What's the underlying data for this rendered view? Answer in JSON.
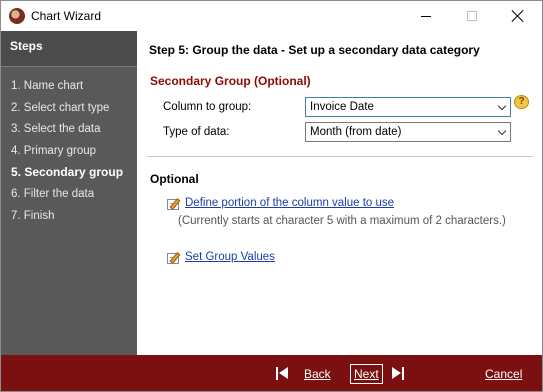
{
  "window": {
    "title": "Chart Wizard"
  },
  "sidebar": {
    "header": "Steps",
    "steps": [
      {
        "label": "1. Name chart"
      },
      {
        "label": "2. Select chart type"
      },
      {
        "label": "3. Select the data"
      },
      {
        "label": "4. Primary group"
      },
      {
        "label": "5. Secondary group"
      },
      {
        "label": "6. Filter the data"
      },
      {
        "label": "7. Finish"
      }
    ],
    "active_step": 4
  },
  "main": {
    "heading": "Step 5: Group the data - Set up a secondary data category",
    "secondary_group": {
      "title": "Secondary Group (Optional)",
      "column_label": "Column to group:",
      "column_value": "Invoice Date",
      "type_label": "Type of data:",
      "type_value": "Month (from date)"
    },
    "optional": {
      "title": "Optional",
      "define_link": "Define portion of the column value to use",
      "define_note": "(Currently starts at character 5 with a maximum of 2 characters.)",
      "group_link": "Set Group Values"
    }
  },
  "footer": {
    "back": "Back",
    "next": "Next",
    "cancel": "Cancel"
  },
  "colors": {
    "sidebar_bg": "#595959",
    "footer_bg": "#7a1010",
    "section_title": "#8b0a0a",
    "link": "#1a3fa8"
  }
}
